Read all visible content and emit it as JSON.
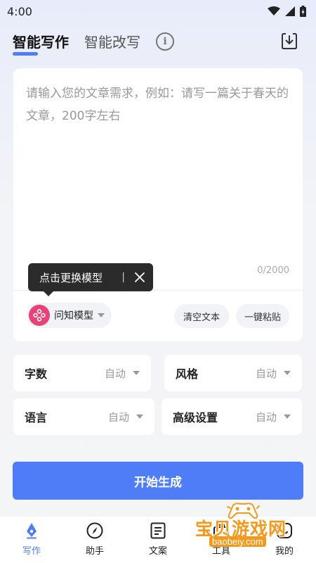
{
  "status_bar": {
    "time": "4:00"
  },
  "header": {
    "tabs": [
      {
        "label": "智能写作",
        "active": true
      },
      {
        "label": "智能改写",
        "active": false
      }
    ],
    "info_label": "i"
  },
  "editor": {
    "placeholder": "请输入您的文章需求，例如：请写一篇关于春天的文章，200字左右",
    "value": "",
    "counter": "0/2000"
  },
  "model_selector": {
    "label": "问知模型"
  },
  "tooltip": {
    "text": "点击更换模型",
    "separator": "|"
  },
  "actions": {
    "clear_label": "清空文本",
    "paste_label": "一键粘贴"
  },
  "options": [
    {
      "label": "字数",
      "value": "自动"
    },
    {
      "label": "风格",
      "value": "自动"
    },
    {
      "label": "语言",
      "value": "自动"
    },
    {
      "label": "高级设置",
      "value": "自动"
    }
  ],
  "start_button": {
    "label": "开始生成"
  },
  "bottom_nav": {
    "items": [
      {
        "label": "写作",
        "icon": "pen-nib-icon",
        "active": true
      },
      {
        "label": "助手",
        "icon": "compass-icon",
        "active": false
      },
      {
        "label": "文案",
        "icon": "document-icon",
        "active": false
      },
      {
        "label": "工具",
        "icon": "toolbox-icon",
        "active": false
      },
      {
        "label": "我的",
        "icon": "profile-icon",
        "active": false
      }
    ]
  },
  "watermark": {
    "text": "宝贝游戏网",
    "url": "baobeiy.com"
  },
  "colors": {
    "accent": "#4f7cf7",
    "model_icon": "#e84278",
    "tooltip_bg": "#2b2b2b",
    "watermark": "#f39a1d"
  }
}
